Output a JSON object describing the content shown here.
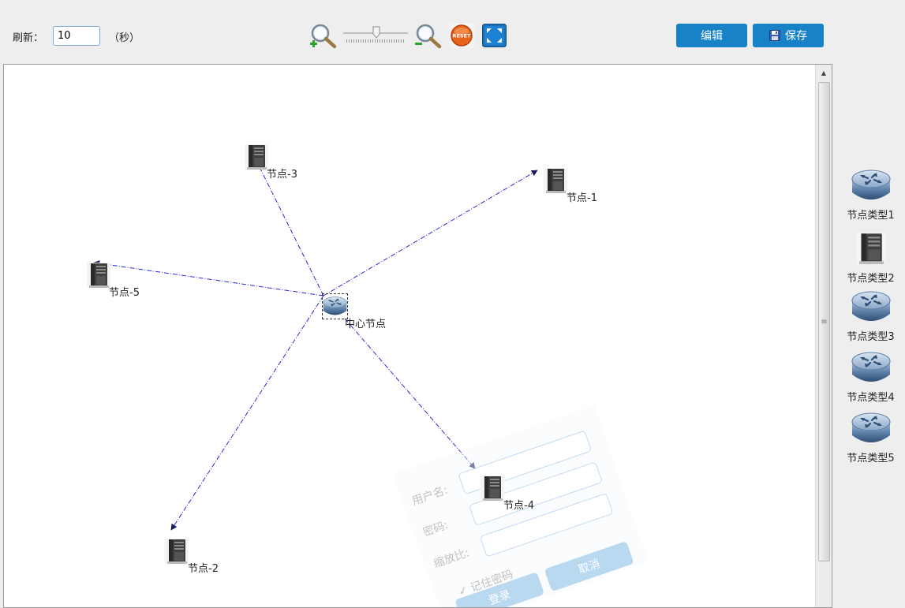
{
  "toolbar": {
    "refresh_label": "刷新：",
    "refresh_value": "10",
    "refresh_unit": "（秒）",
    "zoom_in_icon": "zoom-in-icon",
    "zoom_out_icon": "zoom-out-icon",
    "reset_icon": "reset-icon",
    "reset_text": "RESET",
    "fit_icon": "fit-screen-icon",
    "edit_label": "编辑",
    "save_label": "保存"
  },
  "topology": {
    "center": {
      "label": "中心节点",
      "icon": "router-icon"
    },
    "nodes": [
      {
        "label": "节点-1",
        "icon": "server-icon"
      },
      {
        "label": "节点-2",
        "icon": "server-icon"
      },
      {
        "label": "节点-3",
        "icon": "server-icon"
      },
      {
        "label": "节点-4",
        "icon": "server-icon"
      },
      {
        "label": "节点-5",
        "icon": "server-icon"
      }
    ]
  },
  "login_overlay": {
    "username_label": "用户名:",
    "password_label": "密码:",
    "zoom_label": "缩放比:",
    "remember_label": "记住密码",
    "login_button": "登录",
    "cancel_button": "取消"
  },
  "sidebar": {
    "types": [
      {
        "label": "节点类型1",
        "icon": "router-icon"
      },
      {
        "label": "节点类型2",
        "icon": "server-icon"
      },
      {
        "label": "节点类型3",
        "icon": "router-icon"
      },
      {
        "label": "节点类型4",
        "icon": "router-icon"
      },
      {
        "label": "节点类型5",
        "icon": "router-icon"
      }
    ]
  },
  "colors": {
    "accent": "#1782c6",
    "link": "#2a2ad0",
    "arrow": "#1a1a5e"
  }
}
